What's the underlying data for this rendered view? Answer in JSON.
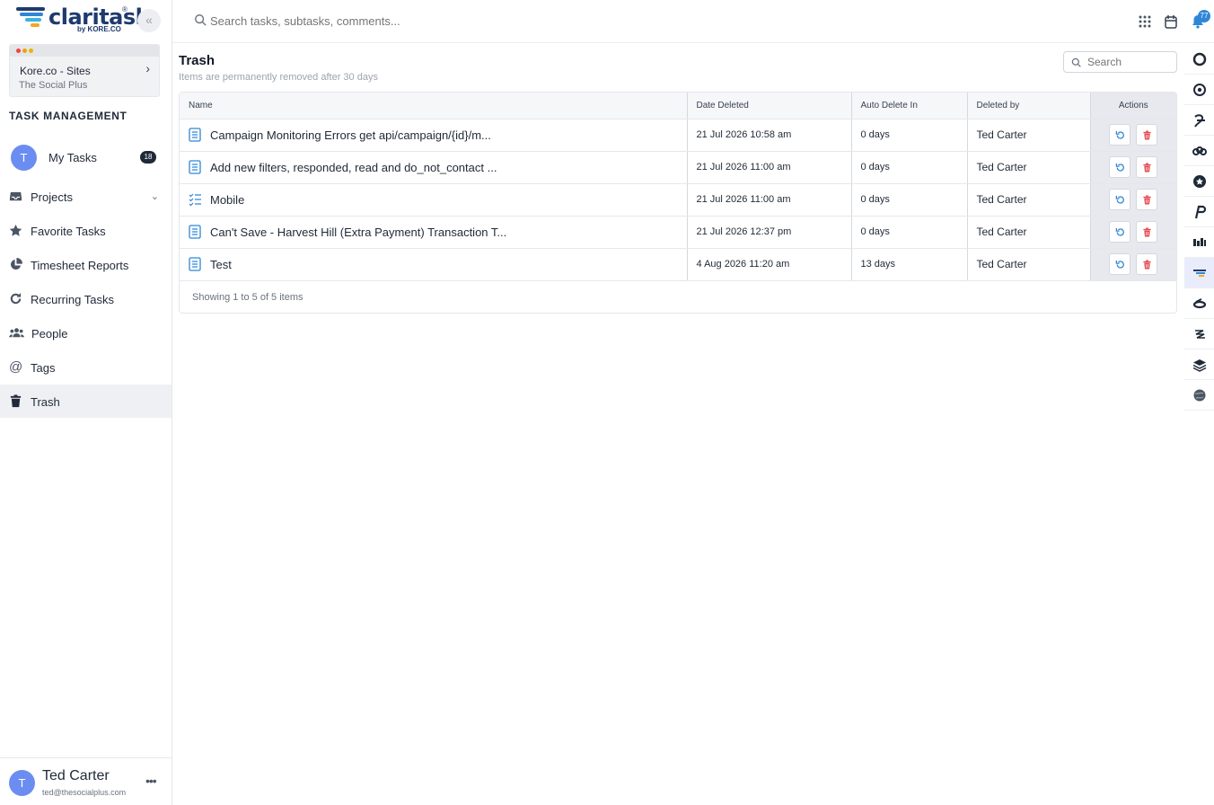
{
  "app": {
    "logo_text": "claritask",
    "logo_sub": "by KORE.CO",
    "logo_reg": "®"
  },
  "workspace": {
    "name": "Kore.co - Sites",
    "sub": "The Social Plus"
  },
  "sidebar": {
    "section_title": "TASK MANAGEMENT",
    "my_tasks": {
      "avatar": "T",
      "label": "My Tasks",
      "count": "18"
    },
    "items": [
      {
        "label": "Projects",
        "icon": "inbox-icon"
      },
      {
        "label": "Favorite Tasks",
        "icon": "star-icon"
      },
      {
        "label": "Timesheet Reports",
        "icon": "pie-chart-icon"
      },
      {
        "label": "Recurring Tasks",
        "icon": "refresh-icon"
      },
      {
        "label": "People",
        "icon": "users-icon"
      },
      {
        "label": "Tags",
        "icon": "at-icon"
      },
      {
        "label": "Trash",
        "icon": "trash-icon"
      }
    ]
  },
  "user": {
    "avatar": "T",
    "name": "Ted Carter",
    "email": "ted@thesocialplus.com"
  },
  "topbar": {
    "search_placeholder": "Search tasks, subtasks, comments...",
    "notification_count": "77"
  },
  "page": {
    "title": "Trash",
    "subtitle": "Items are permanently removed after 30 days",
    "search_placeholder": "Search"
  },
  "table": {
    "headers": {
      "name": "Name",
      "date_deleted": "Date Deleted",
      "auto_delete": "Auto Delete In",
      "deleted_by": "Deleted by",
      "actions": "Actions"
    },
    "rows": [
      {
        "name": "Campaign Monitoring Errors get api/campaign/{id}/m...",
        "icon": "document-icon",
        "date": "21 Jul 2026 10:58 am",
        "auto": "0 days",
        "by": "Ted Carter"
      },
      {
        "name": "Add new filters, responded, read and do_not_contact ...",
        "icon": "document-icon",
        "date": "21 Jul 2026 11:00 am",
        "auto": "0 days",
        "by": "Ted Carter"
      },
      {
        "name": "Mobile",
        "icon": "checklist-icon",
        "date": "21 Jul 2026 11:00 am",
        "auto": "0 days",
        "by": "Ted Carter"
      },
      {
        "name": "Can't Save - Harvest Hill (Extra Payment) Transaction T...",
        "icon": "document-icon",
        "date": "21 Jul 2026 12:37 pm",
        "auto": "0 days",
        "by": "Ted Carter"
      },
      {
        "name": "Test",
        "icon": "document-icon",
        "date": "4 Aug 2026 11:20 am",
        "auto": "13 days",
        "by": "Ted Carter"
      }
    ],
    "footer": "Showing 1 to 5 of 5 items"
  },
  "colors": {
    "accent": "#2f86d6",
    "danger": "#e5484d",
    "avatar": "#6b8df2"
  }
}
